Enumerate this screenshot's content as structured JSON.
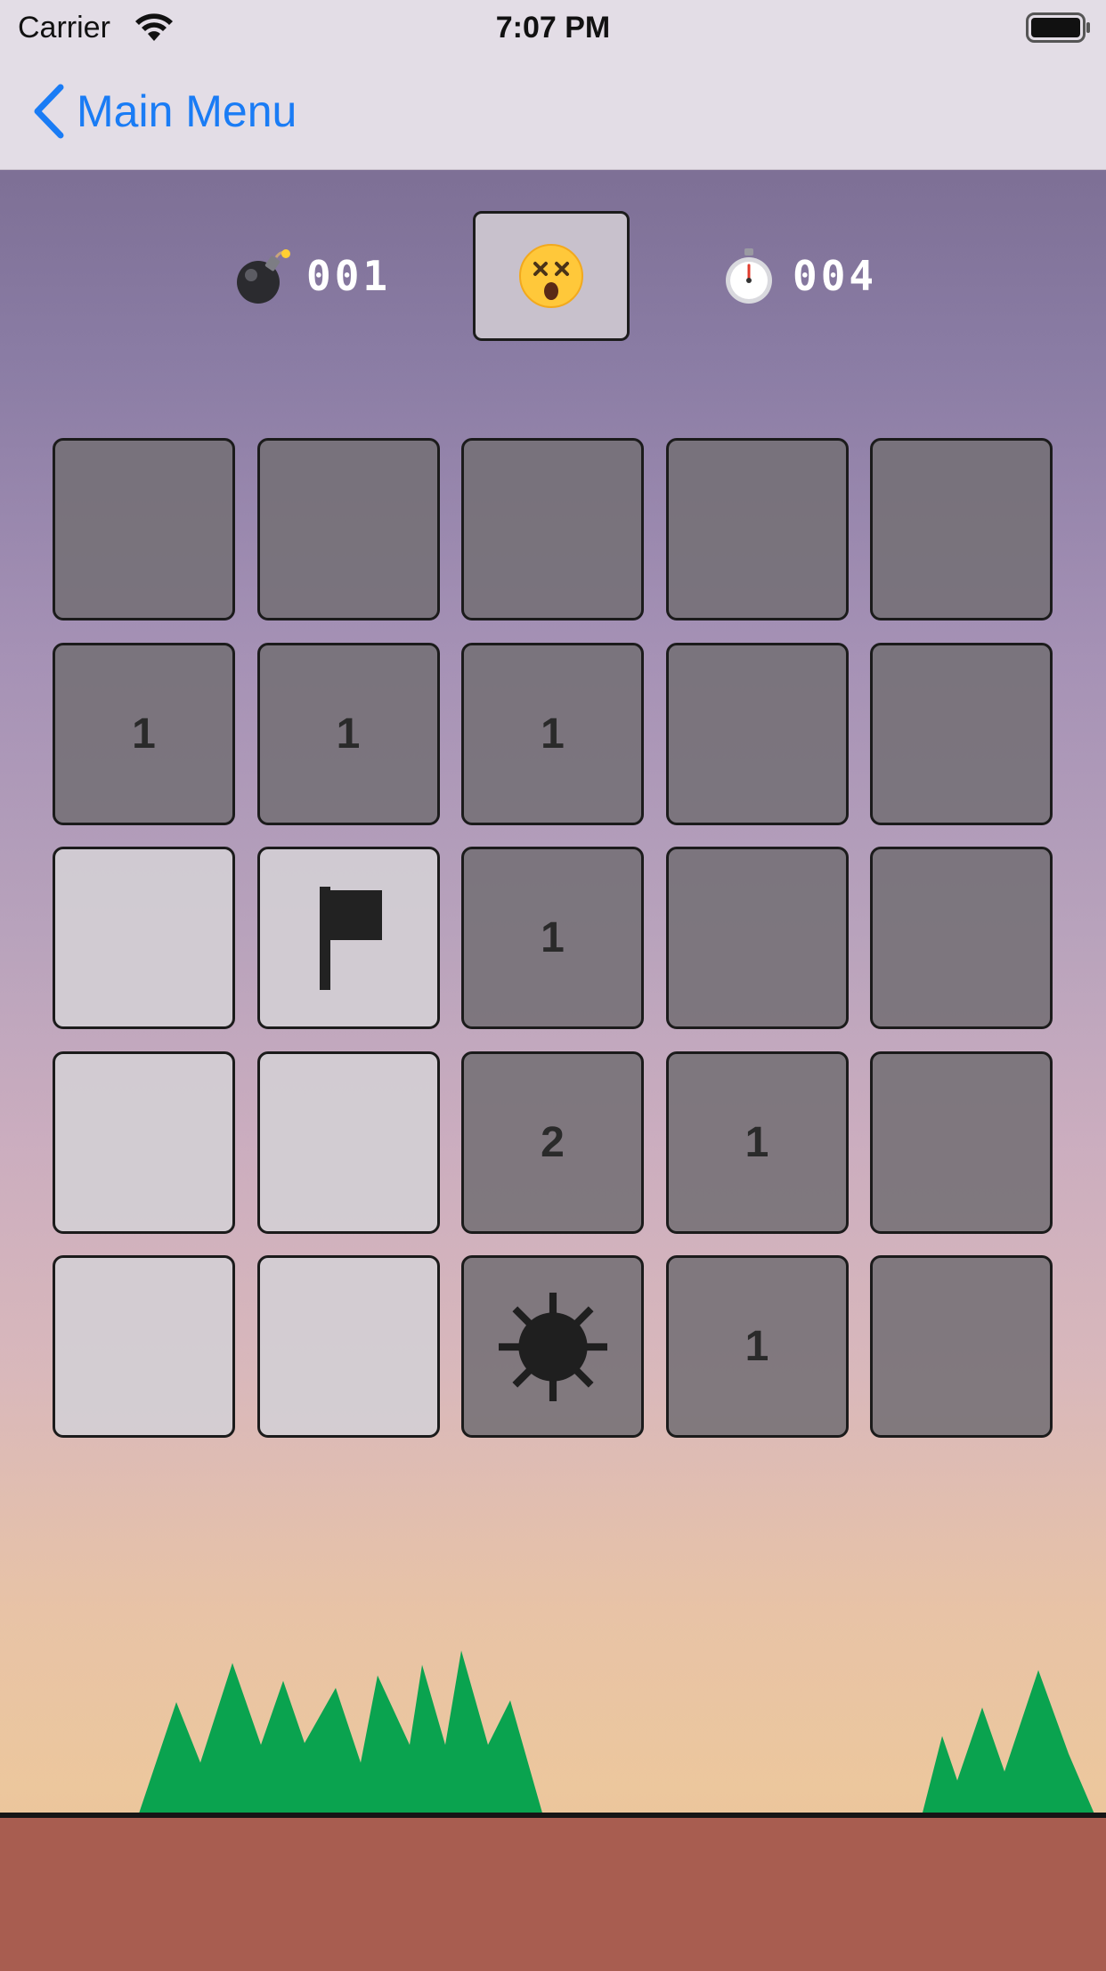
{
  "status_bar": {
    "carrier": "Carrier",
    "time": "7:07 PM",
    "wifi_icon": "wifi-icon",
    "battery_icon": "battery-icon"
  },
  "nav": {
    "back_label": "Main Menu",
    "back_icon": "chevron-left-icon",
    "accent_color": "#1a7cf5"
  },
  "header": {
    "bomb_icon": "bomb-icon",
    "bomb_count": "001",
    "face_icon": "dizzy-face-icon",
    "timer_icon": "stopwatch-icon",
    "timer": "004"
  },
  "board": {
    "rows": 5,
    "cols": 5,
    "cells": [
      [
        {
          "state": "unrevealed",
          "text": ""
        },
        {
          "state": "unrevealed",
          "text": ""
        },
        {
          "state": "unrevealed",
          "text": ""
        },
        {
          "state": "unrevealed",
          "text": ""
        },
        {
          "state": "unrevealed",
          "text": ""
        }
      ],
      [
        {
          "state": "unrevealed",
          "text": "1"
        },
        {
          "state": "unrevealed",
          "text": "1"
        },
        {
          "state": "unrevealed",
          "text": "1"
        },
        {
          "state": "unrevealed",
          "text": ""
        },
        {
          "state": "unrevealed",
          "text": ""
        }
      ],
      [
        {
          "state": "revealed",
          "text": ""
        },
        {
          "state": "revealed",
          "icon": "flag-icon"
        },
        {
          "state": "unrevealed",
          "text": "1"
        },
        {
          "state": "unrevealed",
          "text": ""
        },
        {
          "state": "unrevealed",
          "text": ""
        }
      ],
      [
        {
          "state": "revealed",
          "text": ""
        },
        {
          "state": "revealed",
          "text": ""
        },
        {
          "state": "unrevealed",
          "text": "2"
        },
        {
          "state": "unrevealed",
          "text": "1"
        },
        {
          "state": "unrevealed",
          "text": ""
        }
      ],
      [
        {
          "state": "revealed",
          "text": ""
        },
        {
          "state": "revealed",
          "text": ""
        },
        {
          "state": "unrevealed",
          "icon": "mine-icon"
        },
        {
          "state": "unrevealed",
          "text": "1"
        },
        {
          "state": "unrevealed",
          "text": ""
        }
      ]
    ]
  },
  "colors": {
    "grass": "#0aa34f",
    "ground": "#a85d50"
  }
}
